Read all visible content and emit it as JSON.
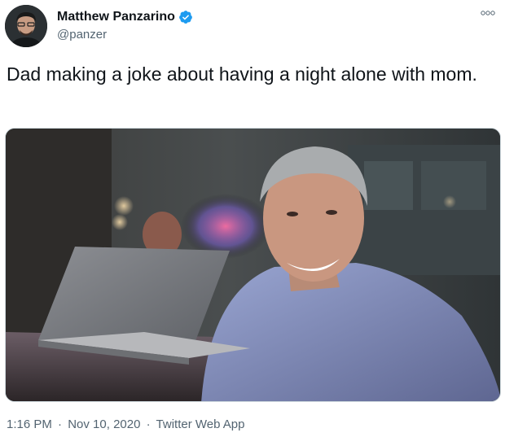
{
  "tweet": {
    "author_name": "Matthew Panzarino",
    "handle": "@panzer",
    "text": "Dad making a joke about having a night alone with mom.",
    "time": "1:16 PM",
    "separator1": "·",
    "date": "Nov 10, 2020",
    "separator2": "·",
    "source": "Twitter Web App"
  },
  "icons": {
    "verified": "verified-badge-icon",
    "more": "more-options-icon"
  },
  "colors": {
    "verified_blue": "#1d9bf0",
    "secondary_text": "#536471"
  }
}
